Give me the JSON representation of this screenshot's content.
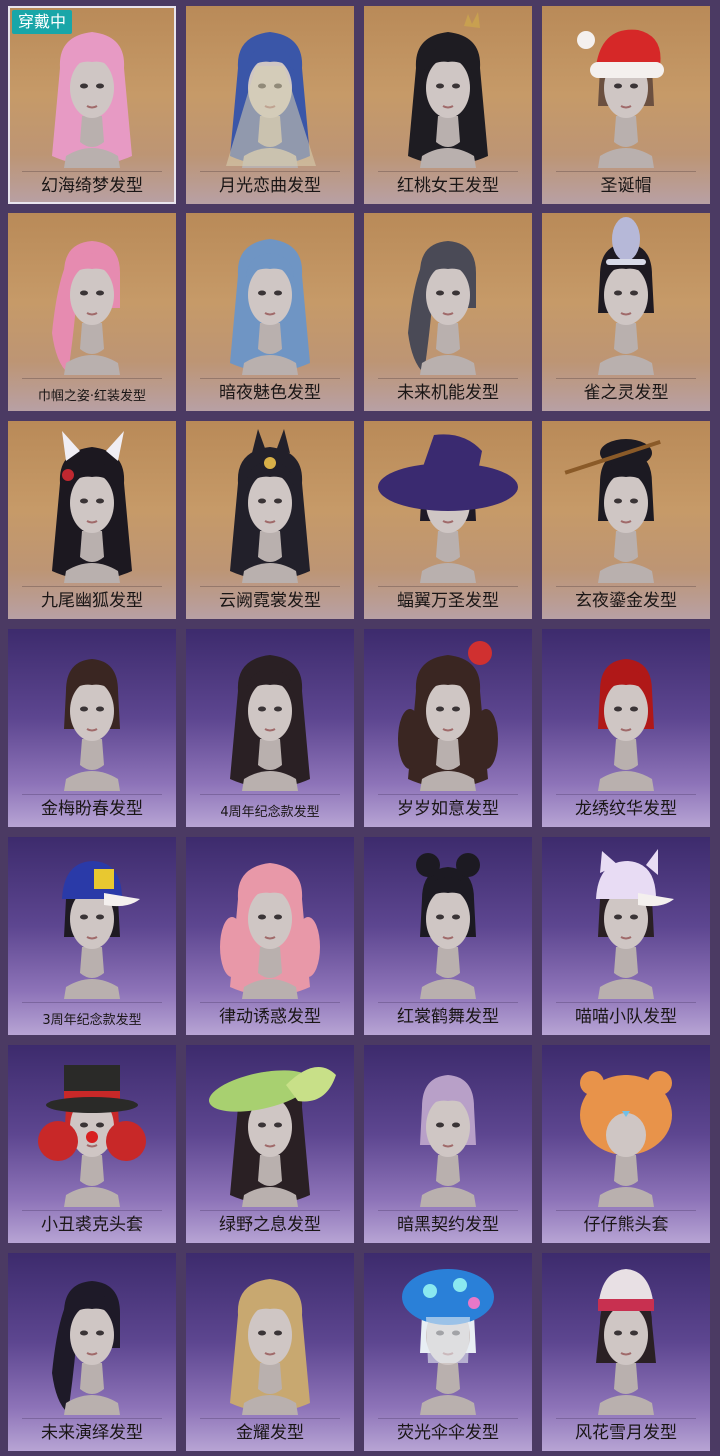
{
  "badge": "穿戴中",
  "items": [
    {
      "label": "幻海绮梦发型",
      "theme": "gold",
      "hair": "#e79ac4",
      "accent": "#7fd0e8",
      "style": "long"
    },
    {
      "label": "月光恋曲发型",
      "theme": "gold",
      "hair": "#3a56a8",
      "accent": "#d9d2b0",
      "style": "veil"
    },
    {
      "label": "红桃女王发型",
      "theme": "gold",
      "hair": "#1e1c22",
      "accent": "#b03030",
      "style": "crown"
    },
    {
      "label": "圣诞帽",
      "theme": "gold",
      "hair": "#6b5040",
      "accent": "#d62828",
      "style": "santa"
    },
    {
      "label": "巾帼之姿·红装发型",
      "theme": "gold",
      "hair": "#e68bb0",
      "accent": "#b02030",
      "style": "pony"
    },
    {
      "label": "暗夜魅色发型",
      "theme": "gold",
      "hair": "#6f95c4",
      "accent": "#2a3550",
      "style": "long"
    },
    {
      "label": "未来机能发型",
      "theme": "gold",
      "hair": "#4a4a56",
      "accent": "#8a8a96",
      "style": "pony"
    },
    {
      "label": "雀之灵发型",
      "theme": "gold",
      "hair": "#1e1a22",
      "accent": "#b6b8d8",
      "style": "feather"
    },
    {
      "label": "九尾幽狐发型",
      "theme": "gold",
      "hair": "#1c1820",
      "accent": "#f0eef4",
      "style": "fox"
    },
    {
      "label": "云阙霓裳发型",
      "theme": "gold",
      "hair": "#22202a",
      "accent": "#d8b048",
      "style": "ornate"
    },
    {
      "label": "蝠翼万圣发型",
      "theme": "gold",
      "hair": "#1e1a26",
      "accent": "#3a2a70",
      "style": "witch"
    },
    {
      "label": "玄夜鎏金发型",
      "theme": "gold",
      "hair": "#1c1a22",
      "accent": "#8a5a28",
      "style": "bun"
    },
    {
      "label": "金梅盼春发型",
      "theme": "purple",
      "hair": "#3a2622",
      "accent": "#3a2622",
      "style": "short"
    },
    {
      "label": "4周年纪念款发型",
      "theme": "purple",
      "hair": "#2a2024",
      "accent": "#3ab0c0",
      "style": "long"
    },
    {
      "label": "岁岁如意发型",
      "theme": "purple",
      "hair": "#3a2622",
      "accent": "#d03030",
      "style": "twin"
    },
    {
      "label": "龙绣纹华发型",
      "theme": "purple",
      "hair": "#b01818",
      "accent": "#b01818",
      "style": "bob"
    },
    {
      "label": "3周年纪念款发型",
      "theme": "purple",
      "hair": "#1e1a22",
      "accent": "#e8c830",
      "style": "cap"
    },
    {
      "label": "律动诱惑发型",
      "theme": "purple",
      "hair": "#e898a8",
      "accent": "#e898a8",
      "style": "twin"
    },
    {
      "label": "红裳鹤舞发型",
      "theme": "purple",
      "hair": "#1c1a22",
      "accent": "#1c1a22",
      "style": "buns"
    },
    {
      "label": "喵喵小队发型",
      "theme": "purple",
      "hair": "#2a2024",
      "accent": "#e8dcf4",
      "style": "catcap"
    },
    {
      "label": "小丑裘克头套",
      "theme": "purple",
      "hair": "#c82828",
      "accent": "#2a2a28",
      "style": "clown"
    },
    {
      "label": "绿野之息发型",
      "theme": "purple",
      "hair": "#2a2024",
      "accent": "#a8d070",
      "style": "green"
    },
    {
      "label": "暗黑契约发型",
      "theme": "purple",
      "hair": "#b8a0c8",
      "accent": "#b8a0c8",
      "style": "short"
    },
    {
      "label": "仔仔熊头套",
      "theme": "purple",
      "hair": "#e8934a",
      "accent": "#70c0e8",
      "style": "bear"
    },
    {
      "label": "未来演绎发型",
      "theme": "purple",
      "hair": "#1e1a28",
      "accent": "#40c8d8",
      "style": "pony"
    },
    {
      "label": "金耀发型",
      "theme": "purple",
      "hair": "#c8a870",
      "accent": "#c8a870",
      "style": "long"
    },
    {
      "label": "荧光伞伞发型",
      "theme": "purple",
      "hair": "#e8eef4",
      "accent": "#2a80d8",
      "style": "mushroom"
    },
    {
      "label": "风花雪月发型",
      "theme": "purple",
      "hair": "#2a2024",
      "accent": "#c83050",
      "style": "miao"
    }
  ]
}
